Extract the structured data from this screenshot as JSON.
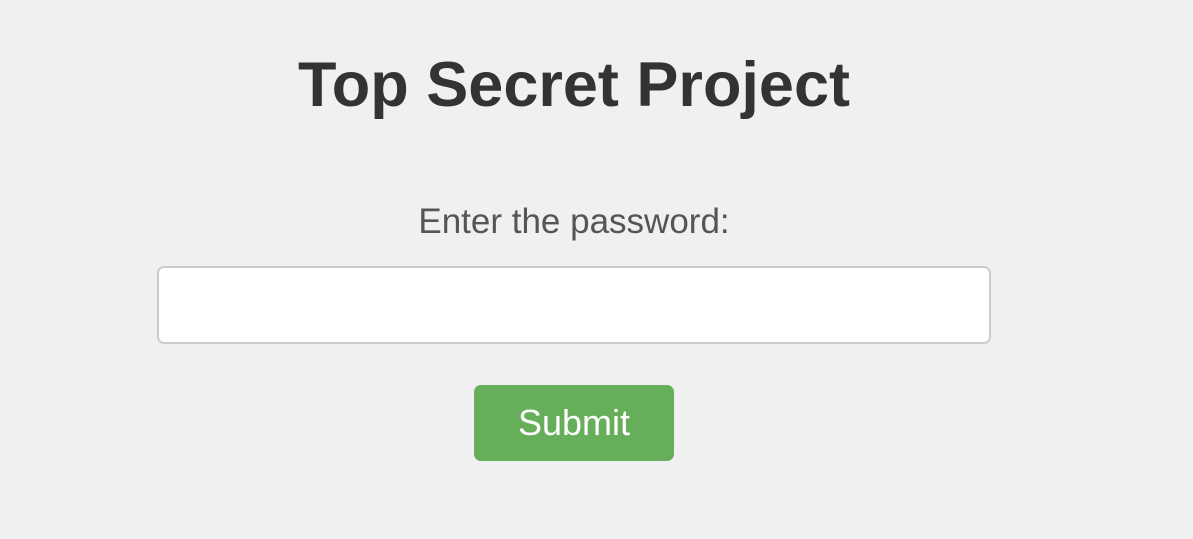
{
  "header": {
    "title": "Top Secret Project"
  },
  "form": {
    "prompt_label": "Enter the password:",
    "password": {
      "value": "",
      "placeholder": ""
    },
    "submit_label": "Submit"
  },
  "colors": {
    "background": "#f0f0f0",
    "title_text": "#333333",
    "label_text": "#555555",
    "submit_button": "#67ae5b"
  }
}
